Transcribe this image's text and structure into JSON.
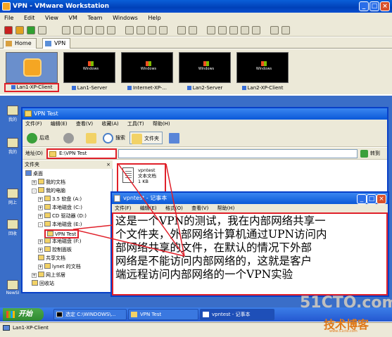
{
  "window": {
    "title": "VPN - VMware Workstation",
    "controls": [
      "_",
      "□",
      "×"
    ]
  },
  "menu": [
    "File",
    "Edit",
    "View",
    "VM",
    "Team",
    "Windows",
    "Help"
  ],
  "tabs": [
    {
      "label": "Home",
      "icon": "home-icon"
    },
    {
      "label": "VPN",
      "icon": "team-icon"
    }
  ],
  "thumbnails": [
    {
      "label": "Lan1-XP-Client",
      "selected": true
    },
    {
      "label": "Lan1-Server"
    },
    {
      "label": "Internet-XP-..."
    },
    {
      "label": "Lan2-Server"
    },
    {
      "label": "Lan2-XP-Client"
    }
  ],
  "desktop_icons": [
    "我的",
    "我的",
    "网上",
    "回收",
    "NewSI"
  ],
  "explorer": {
    "title": "VPN Test",
    "menu": [
      "文件(F)",
      "编辑(E)",
      "查看(V)",
      "收藏(A)",
      "工具(T)",
      "帮助(H)"
    ],
    "toolbar": {
      "back": "后退",
      "search": "搜索",
      "folders": "文件夹"
    },
    "address_label": "地址(D)",
    "address_value": "E:\\VPN Test",
    "go_label": "转到",
    "pane_title": "文件夹",
    "tree": [
      {
        "label": "桌面",
        "level": 0,
        "expander": ""
      },
      {
        "label": "我的文档",
        "level": 1,
        "expander": "+"
      },
      {
        "label": "我的电脑",
        "level": 1,
        "expander": "-"
      },
      {
        "label": "3.5 软盘 (A:)",
        "level": 2,
        "expander": "+"
      },
      {
        "label": "本地磁盘 (C:)",
        "level": 2,
        "expander": "+"
      },
      {
        "label": "CD 驱动器 (D:)",
        "level": 2,
        "expander": "+"
      },
      {
        "label": "本地磁盘 (E:)",
        "level": 2,
        "expander": "-"
      },
      {
        "label": "VPN Test",
        "level": 3,
        "expander": "",
        "selected": true
      },
      {
        "label": "本地磁盘 (F:)",
        "level": 2,
        "expander": "+"
      },
      {
        "label": "控制面板",
        "level": 2,
        "expander": "+"
      },
      {
        "label": "共享文档",
        "level": 2,
        "expander": ""
      },
      {
        "label": "lynet 的文档",
        "level": 2,
        "expander": "+"
      },
      {
        "label": "网上邻居",
        "level": 1,
        "expander": "+"
      },
      {
        "label": "回收站",
        "level": 1,
        "expander": ""
      }
    ],
    "file": {
      "name": "vpntest",
      "type": "文本文档",
      "size": "1 KB"
    }
  },
  "notepad": {
    "title": "vpntest - 记事本",
    "menu": [
      "文件(F)",
      "编辑(E)",
      "格式(O)",
      "查看(V)",
      "帮助(H)"
    ],
    "lines": [
      "这是一个VPN的测试，我在内部网络共享一",
      "个文件夹，外部网络计算机通过UPN访问内",
      "部网络共享的文件，在默认的情况下外部",
      "网络是不能访问内部网络的，这就是客户",
      "端远程访问内部网络的一个VPN实验"
    ]
  },
  "taskbar": {
    "start": "开始",
    "tasks": [
      "选定 C:\\WINDOWS\\...",
      "VPN Test",
      "vpntest - 记事本"
    ]
  },
  "statusbar": "Lan1-XP-Client",
  "watermark": {
    "line1": "51CTO.com",
    "line2": "技术博客",
    "line3": "www.51cto.com"
  },
  "colors": {
    "highlight": "#e0202a",
    "xp_blue": "#0840c8",
    "desktop": "#3a6ec8"
  }
}
